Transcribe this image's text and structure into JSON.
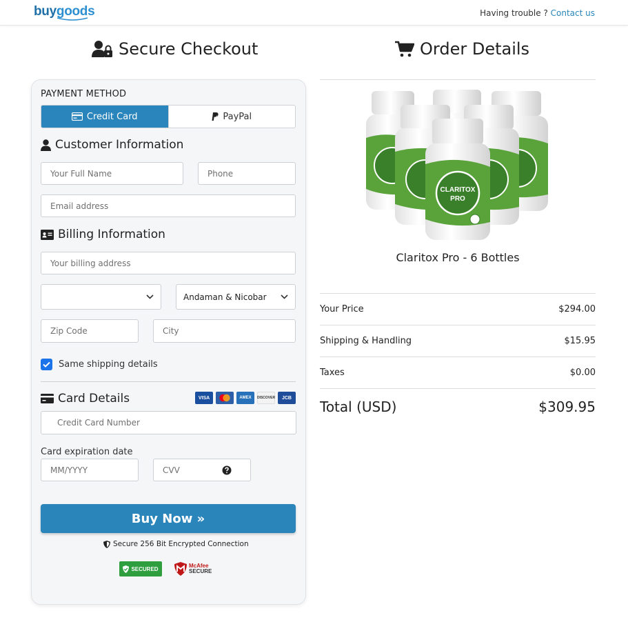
{
  "header": {
    "logo_buy": "buy",
    "logo_goods": "goods",
    "help_text": "Having trouble ? ",
    "contact_link": "Contact us"
  },
  "checkout": {
    "title": "Secure Checkout",
    "payment_method_label": "PAYMENT METHOD",
    "tabs": [
      {
        "label": "Credit Card",
        "active": true
      },
      {
        "label": "PayPal",
        "active": false
      }
    ],
    "customer": {
      "title": "Customer Information",
      "full_name_placeholder": "Your Full Name",
      "phone_placeholder": "Phone",
      "email_placeholder": "Email address"
    },
    "billing": {
      "title": "Billing Information",
      "address_placeholder": "Your billing address",
      "country_value": "",
      "state_value": "Andaman & Nicobar",
      "zip_placeholder": "Zip Code",
      "city_placeholder": "City",
      "same_shipping_label": "Same shipping details",
      "same_shipping_checked": true
    },
    "card": {
      "title": "Card Details",
      "brands": [
        "VISA",
        "Mastercard",
        "AMEX",
        "DISCOVER",
        "JCB"
      ],
      "number_placeholder": "Credit Card Number",
      "expiration_label": "Card expiration date",
      "expiry_placeholder": "MM/YYYY",
      "cvv_placeholder": "CVV"
    },
    "buy_button": "Buy Now »",
    "secure_note": "Secure 256 Bit Encrypted Connection",
    "badge_trust": "SECURED",
    "badge_mcafee_1": "McAfee",
    "badge_mcafee_2": "SECURE"
  },
  "order": {
    "title": "Order Details",
    "product_name": "Claritox Pro - 6 Bottles",
    "bottle_label_1": "CLARITOX",
    "bottle_label_2": "PRO",
    "lines": [
      {
        "label": "Your Price",
        "value": "$294.00"
      },
      {
        "label": "Shipping & Handling",
        "value": "$15.95"
      },
      {
        "label": "Taxes",
        "value": "$0.00"
      }
    ],
    "total_label": "Total (USD)",
    "total_value": "$309.95"
  },
  "colors": {
    "primary": "#2a85bb",
    "checkbox": "#1a73e8",
    "bottle_green": "#5aa33b"
  }
}
